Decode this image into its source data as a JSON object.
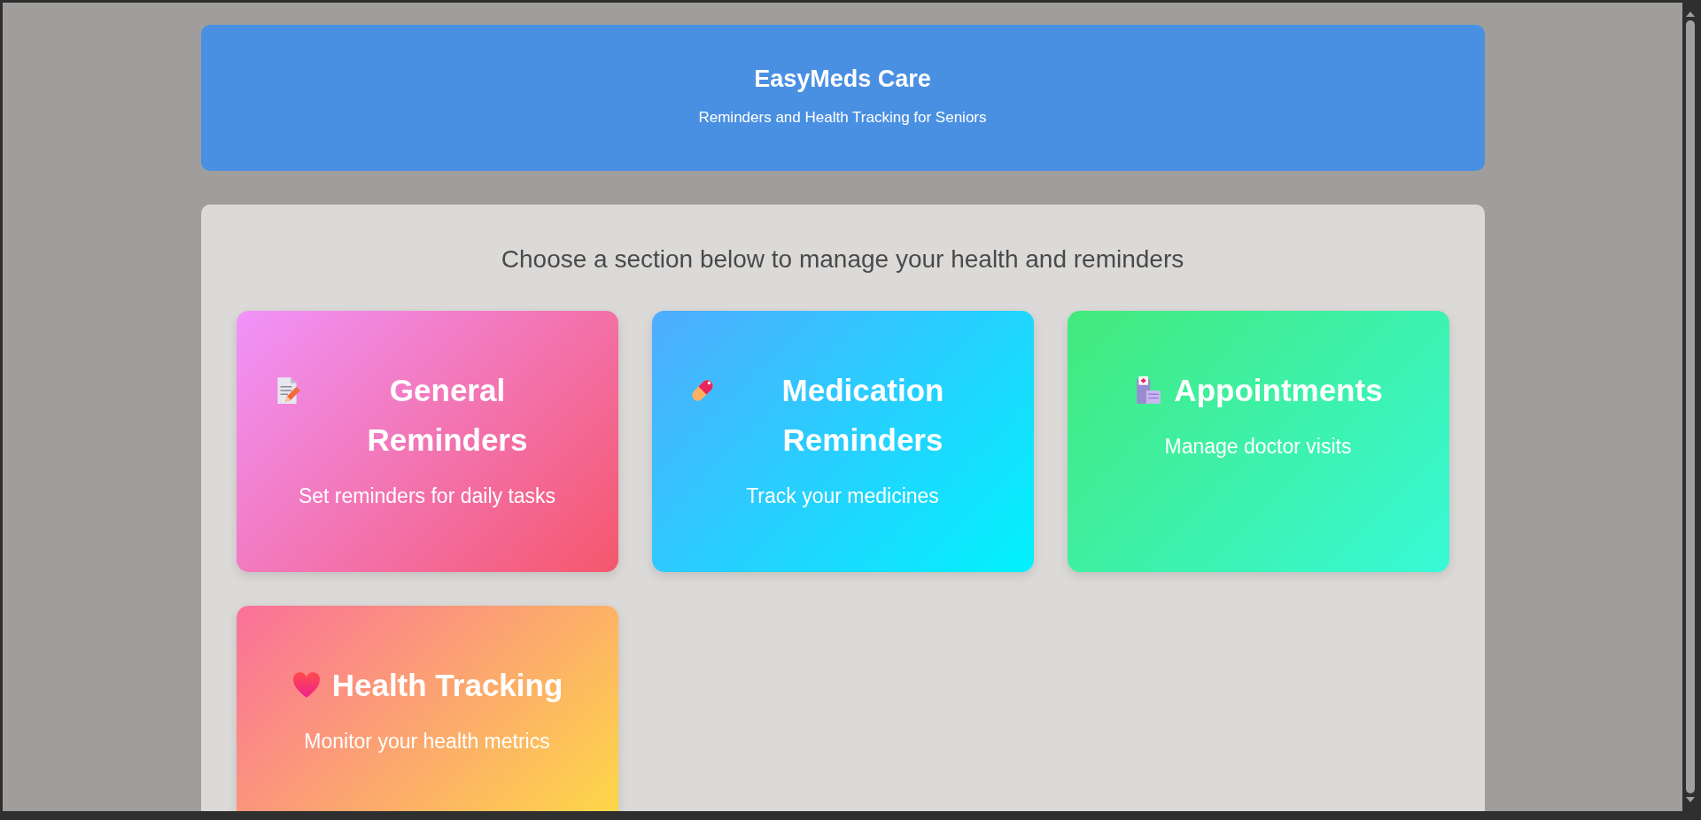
{
  "header": {
    "title": "EasyMeds Care",
    "subtitle": "Reminders and Health Tracking for Seniors"
  },
  "prompt": "Choose a section below to manage your health and reminders",
  "sections": [
    {
      "kind": "general",
      "title": "General Reminders",
      "description": "Set reminders for daily tasks"
    },
    {
      "kind": "medication",
      "title": "Medication Reminders",
      "description": "Track your medicines"
    },
    {
      "kind": "appointments",
      "title": "Appointments",
      "description": "Manage doctor visits"
    },
    {
      "kind": "health",
      "title": "Health Tracking",
      "description": "Monitor your health metrics"
    }
  ]
}
